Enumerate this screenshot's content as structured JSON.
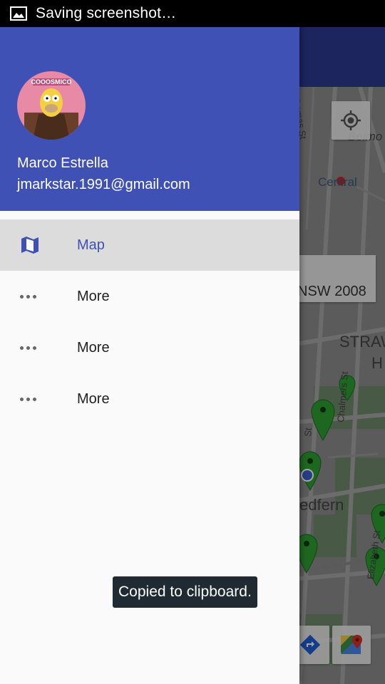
{
  "status_bar": {
    "text": "Saving screenshot…",
    "icon": "image-icon"
  },
  "map": {
    "labels": {
      "central": "Central",
      "belmore": "Belmo",
      "street_thomas": "Thomas St",
      "straw": "STRAW",
      "h": "H",
      "chalmers": "Chalmers St",
      "redfern": "edfern",
      "elizabeth": "Elizabeth St",
      "st_fragment": "St"
    },
    "info_box_text": "NSW 2008",
    "marker_color": "#2e9e33"
  },
  "drawer": {
    "header_color": "#3f51b5",
    "user": {
      "name": "Marco Estrella",
      "email": "jmarkstar.1991@gmail.com",
      "avatar_caption": "COOOSMICO"
    },
    "items": [
      {
        "label": "Map",
        "icon": "map-icon",
        "active": true
      },
      {
        "label": "More",
        "icon": "more-horiz-icon",
        "active": false
      },
      {
        "label": "More",
        "icon": "more-horiz-icon",
        "active": false
      },
      {
        "label": "More",
        "icon": "more-horiz-icon",
        "active": false
      }
    ]
  },
  "toast": {
    "text": "Copied to clipboard."
  },
  "colors": {
    "accent": "#3f51b5",
    "toast_bg": "#1f2a33"
  }
}
